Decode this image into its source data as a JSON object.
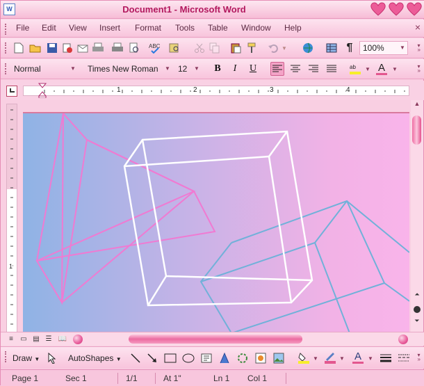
{
  "window": {
    "title": "Document1 - Microsoft Word",
    "app_icon_letter": "W"
  },
  "menu": {
    "items": [
      "File",
      "Edit",
      "View",
      "Insert",
      "Format",
      "Tools",
      "Table",
      "Window",
      "Help"
    ]
  },
  "standard_toolbar": {
    "buttons": [
      "new-icon",
      "open-icon",
      "save-icon",
      "permission-icon",
      "email-icon",
      "print-icon",
      "print-preview-icon",
      "spelling-icon",
      "research-icon",
      "cut-icon",
      "copy-icon",
      "paste-icon",
      "format-painter-icon",
      "undo-icon",
      "redo-icon",
      "hyperlink-icon",
      "tables-borders-icon",
      "show-formatting-icon"
    ],
    "pilcrow": "¶",
    "zoom": "100%"
  },
  "formatting_toolbar": {
    "style": "Normal",
    "font": "Times New Roman",
    "size": "12",
    "bold": "B",
    "italic": "I",
    "underline": "U",
    "font_color_letter": "A"
  },
  "ruler": {
    "labels": [
      "1",
      "2",
      "3",
      "4"
    ]
  },
  "vertical_ruler": {
    "labels": [
      "1"
    ]
  },
  "drawing_toolbar": {
    "draw": "Draw",
    "autoshapes": "AutoShapes",
    "font_color_letter": "A"
  },
  "status": {
    "page": "Page 1",
    "sec": "Sec 1",
    "pages": "1/1",
    "at": "At 1\"",
    "ln": "Ln 1",
    "col": "Col 1"
  },
  "colors": {
    "accent": "#e3578f",
    "title": "#b2185e",
    "cube_white": "#ffffff",
    "cube_pink": "#f07ad2",
    "cube_blue": "#71b1d9"
  }
}
